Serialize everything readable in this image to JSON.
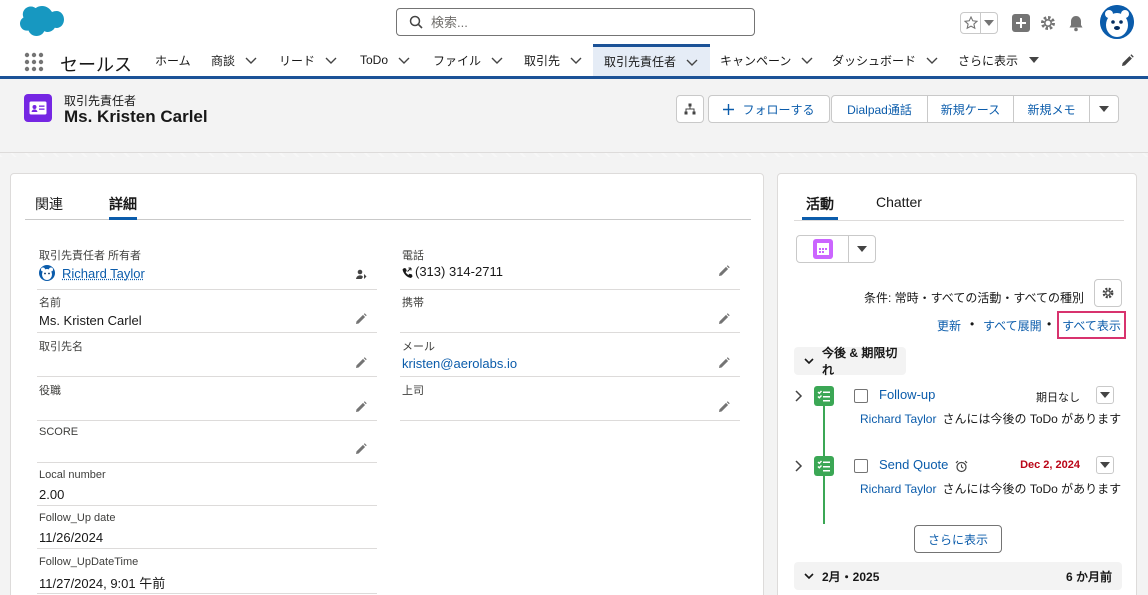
{
  "search": {
    "placeholder": "検索..."
  },
  "app": {
    "name": "セールス"
  },
  "nav": {
    "items": [
      {
        "label": "ホーム",
        "has_menu": false
      },
      {
        "label": "商談",
        "has_menu": true
      },
      {
        "label": "リード",
        "has_menu": true
      },
      {
        "label": "ToDo",
        "has_menu": true
      },
      {
        "label": "ファイル",
        "has_menu": true
      },
      {
        "label": "取引先",
        "has_menu": true
      },
      {
        "label": "取引先責任者",
        "has_menu": true,
        "active": true
      },
      {
        "label": "キャンペーン",
        "has_menu": true
      },
      {
        "label": "ダッシュボード",
        "has_menu": true
      },
      {
        "label": "さらに表示",
        "has_menu": true
      }
    ]
  },
  "record": {
    "type_label": "取引先責任者",
    "name": "Ms. Kristen Carlel",
    "actions": {
      "follow": "フォローする",
      "dialpad": "Dialpad通話",
      "new_case": "新規ケース",
      "new_memo": "新規メモ"
    }
  },
  "detail": {
    "tabs": [
      "関連",
      "詳細"
    ],
    "active_tab": "詳細",
    "left_fields": [
      {
        "label": "取引先責任者 所有者",
        "value": "Richard Taylor"
      },
      {
        "label": "名前",
        "value": "Ms. Kristen Carlel"
      },
      {
        "label": "取引先名",
        "value": ""
      },
      {
        "label": "役職",
        "value": ""
      },
      {
        "label": "SCORE",
        "value": ""
      },
      {
        "label": "Local number",
        "value": "2.00"
      },
      {
        "label": "Follow_Up date",
        "value": "11/26/2024"
      },
      {
        "label": "Follow_UpDateTime",
        "value": "11/27/2024, 9:01 午前"
      }
    ],
    "right_fields": [
      {
        "label": "電話",
        "value": "(313) 314-2711"
      },
      {
        "label": "携帯",
        "value": ""
      },
      {
        "label": "メール",
        "value": "kristen@aerolabs.io"
      },
      {
        "label": "上司",
        "value": ""
      }
    ]
  },
  "activity": {
    "tabs": [
      "活動",
      "Chatter"
    ],
    "active_tab": "活動",
    "filter_text": "条件: 常時・すべての活動・すべての種別",
    "links": {
      "refresh": "更新",
      "expand_all": "すべて展開",
      "show_all": "すべて表示"
    },
    "upcoming_header": "今後 & 期限切れ",
    "tasks": [
      {
        "title": "Follow-up",
        "date": "期日なし",
        "overdue": false,
        "owner": "Richard Taylor",
        "description": "さんには今後の ToDo があります",
        "has_reminder": false
      },
      {
        "title": "Send Quote",
        "date": "Dec 2, 2024",
        "overdue": true,
        "owner": "Richard Taylor",
        "description": "さんには今後の ToDo があります",
        "has_reminder": true
      }
    ],
    "more_button": "さらに表示",
    "month_header": {
      "label": "2月・2025",
      "relative": "6 か月前"
    }
  },
  "colors": {
    "brand": "#0b5cab",
    "nav_active_bg": "#e5ecf6",
    "contact_icon": "#7526e3",
    "task_green": "#3ba755",
    "overdue_red": "#ba0517",
    "highlight_box": "#d8336e"
  },
  "icons": {
    "logo": "salesforce-cloud-icon",
    "search": "search-icon",
    "favorite": "star-icon",
    "add": "plus-icon",
    "setup": "gear-icon",
    "notifications": "bell-icon",
    "user": "avatar",
    "app_launcher": "waffle-icon",
    "edit_nav": "pencil-icon"
  }
}
